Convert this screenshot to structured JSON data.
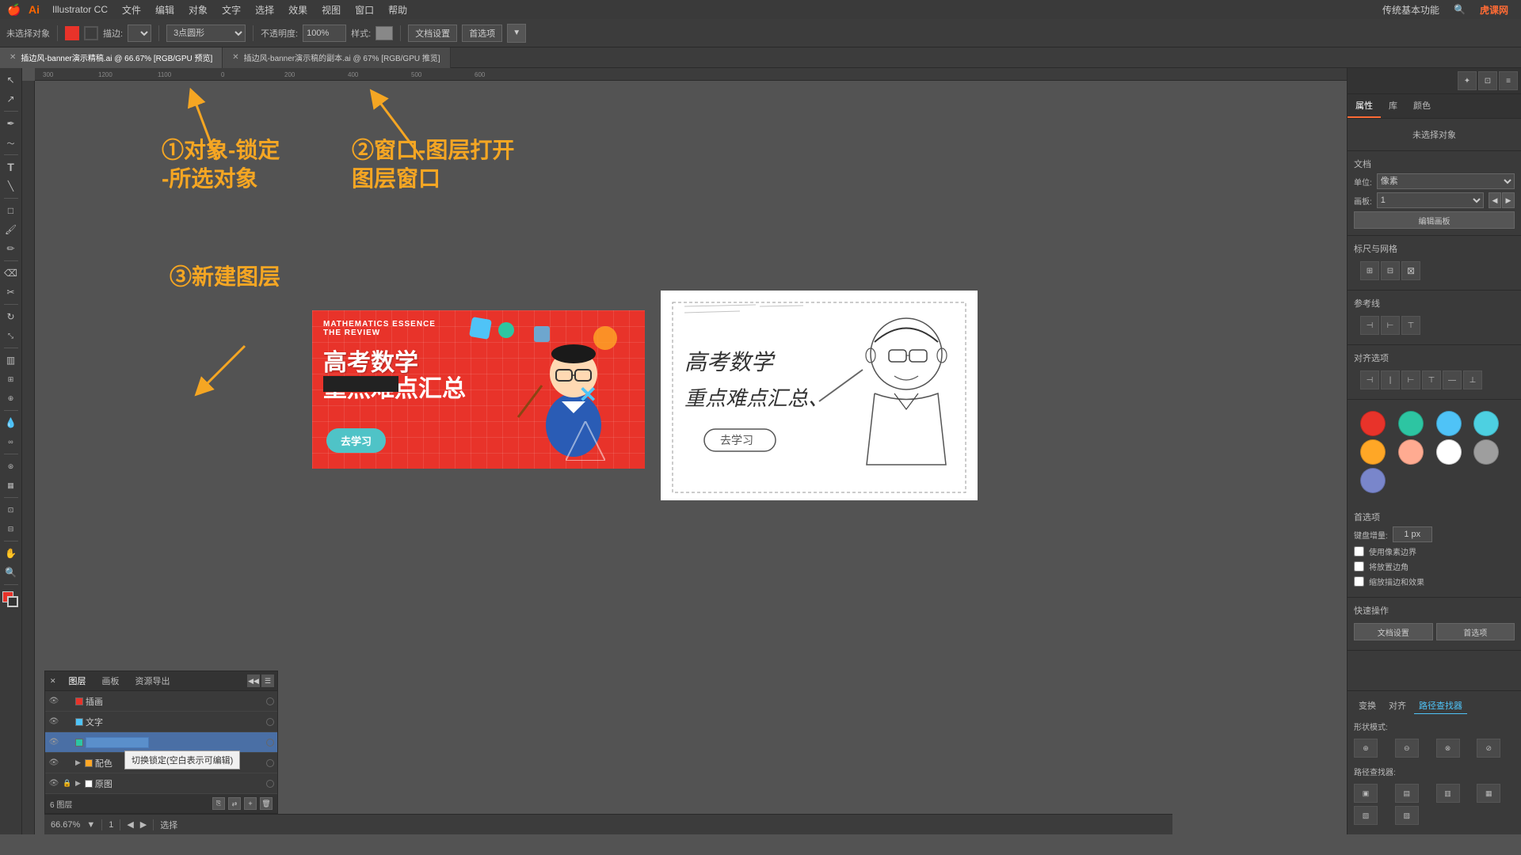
{
  "app": {
    "title": "Illustrator CC",
    "logo": "Ai",
    "version": "CC"
  },
  "menubar": {
    "apple": "🍎",
    "items": [
      "Illustrator CC",
      "文件",
      "编辑",
      "对象",
      "文字",
      "选择",
      "效果",
      "视图",
      "窗口",
      "帮助"
    ],
    "right": "传统基本功能",
    "right2": "虎课网"
  },
  "toolbar": {
    "label": "未选择对象",
    "stroke_label": "描边:",
    "shape_label": "3点圆形",
    "opacity_label": "不透明度:",
    "opacity_value": "100%",
    "style_label": "样式:",
    "doc_settings": "文档设置",
    "preferences": "首选项"
  },
  "tabs": [
    {
      "label": "插边风-banner演示精稿.ai @ 66.67% [RGB/GPU 预览]",
      "active": true
    },
    {
      "label": "插边风-banner演示稿的副本.ai @ 67% [RGB/GPU 推览]",
      "active": false
    }
  ],
  "annotations": {
    "step1": "①对象-锁定\n-所选对象",
    "step2": "②窗口-图层打开\n图层窗口",
    "step3": "③新建图层"
  },
  "right_panel": {
    "tabs": [
      "属性",
      "库",
      "颜色"
    ],
    "active_tab": "属性",
    "title": "未选择对象",
    "doc_section": {
      "label": "文档",
      "unit_label": "单位:",
      "unit_value": "像素",
      "artboard_label": "画板:",
      "artboard_value": "1",
      "edit_artboard_btn": "编辑画板"
    },
    "colors": [
      {
        "color": "#e8332a",
        "name": "red"
      },
      {
        "color": "#2dc5a2",
        "name": "teal"
      },
      {
        "color": "#4fc3f7",
        "name": "light-blue"
      },
      {
        "color": "#4dd0e1",
        "name": "cyan"
      },
      {
        "color": "#ffa726",
        "name": "orange"
      },
      {
        "color": "#ffab91",
        "name": "light-pink"
      },
      {
        "color": "#ffffff",
        "name": "white"
      },
      {
        "color": "#9e9e9e",
        "name": "gray"
      },
      {
        "color": "#7986cb",
        "name": "purple-blue"
      }
    ],
    "rulers_grids": {
      "label": "标尺与网格"
    },
    "guides": {
      "label": "参考线"
    },
    "align": {
      "label": "对齐选项"
    },
    "snapping": {
      "label": "首选项",
      "keyboard_increment": "键盘增量:",
      "keyboard_value": "1 px",
      "snap_pixel_grid": "使用像素边界",
      "round_corners": "将放置边角",
      "remove_effects": "缩放描边和效果"
    },
    "quick_actions": {
      "label": "快速操作",
      "doc_settings_btn": "文档设置",
      "prefs_btn": "首选项"
    },
    "bottom_tabs": [
      "变换",
      "对齐",
      "路径查找器"
    ],
    "active_bottom_tab": "路径查找器",
    "shape_modes_label": "形状模式:",
    "path_finder_label": "路径查找器:"
  },
  "layers_panel": {
    "tabs": [
      "图层",
      "画板",
      "资源导出"
    ],
    "active_tab": "图层",
    "layers": [
      {
        "name": "插画",
        "visible": true,
        "locked": false,
        "color": "#e8332a",
        "circle": true,
        "expanded": false
      },
      {
        "name": "文字",
        "visible": true,
        "locked": false,
        "color": "#4fc3f7",
        "circle": true,
        "expanded": false
      },
      {
        "name": "",
        "visible": true,
        "locked": false,
        "color": "#2dc5a2",
        "circle": true,
        "expanded": false,
        "editing": true
      },
      {
        "name": "配色",
        "visible": true,
        "locked": false,
        "color": "#ffa726",
        "circle": true,
        "expanded": true,
        "has_sub": true
      },
      {
        "name": "原图",
        "visible": true,
        "locked": true,
        "color": "#9e9e9e",
        "circle": true,
        "expanded": false,
        "has_sub": true
      }
    ],
    "footer": {
      "count_label": "6 图层",
      "new_layer_btn": "+",
      "delete_btn": "🗑",
      "options_btn": "☰"
    },
    "tooltip": "切换锁定(空白表示可编辑)"
  },
  "banner": {
    "title_en_line1": "MATHEMATICS ESSENCE",
    "title_en_line2": "THE REVIEW",
    "title_cn_line1": "高考数学",
    "title_cn_line2": "重点难点汇总",
    "button_label": "去学习",
    "decoration_x": "✕"
  },
  "statusbar": {
    "zoom": "66.67%",
    "artboard": "1",
    "mode": "选择"
  }
}
